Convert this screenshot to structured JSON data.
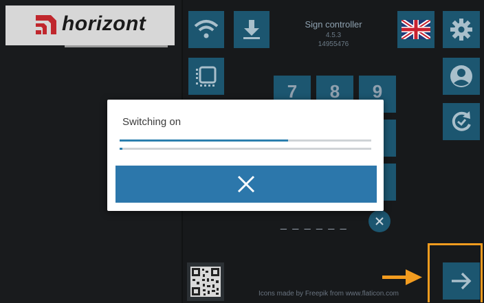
{
  "logo": {
    "text": "horizont"
  },
  "header": {
    "title": "Sign controller",
    "version": "4.5.3",
    "serial": "14955476"
  },
  "keypad": {
    "keys": [
      "7",
      "8",
      "9"
    ]
  },
  "code_entry": {
    "dashes": "_ _ _ _ _ _"
  },
  "footer": {
    "credit": "Icons made by Freepik from www.flaticon.com"
  },
  "dialog": {
    "message": "Switching on",
    "progress_primary": 0.67,
    "progress_secondary": 0.01
  },
  "colors": {
    "tile": "#1c5670",
    "accent": "#2c77ab",
    "highlight": "#f39c1f"
  },
  "icons": [
    "wifi-icon",
    "download-icon",
    "select-icon",
    "uk-flag-icon",
    "gear-icon",
    "user-icon",
    "refresh-icon",
    "qr-code-icon",
    "arrow-right-icon",
    "close-icon"
  ]
}
